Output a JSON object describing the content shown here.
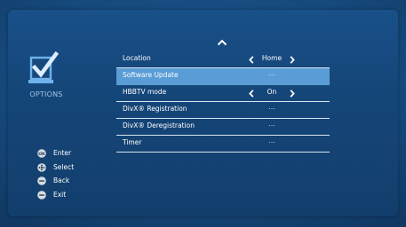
{
  "sidebar": {
    "title": "OPTIONS",
    "icon": "checklist-icon"
  },
  "menu": {
    "items": [
      {
        "label": "Location",
        "value": "Home",
        "selector": true
      },
      {
        "label": "Software Update",
        "value": "...",
        "selected": true
      },
      {
        "label": "HBBTV mode",
        "value": "On",
        "selector": true
      },
      {
        "label": "DivX® Registration",
        "value": "..."
      },
      {
        "label": "DivX® Deregistration",
        "value": "..."
      },
      {
        "label": "Timer",
        "value": "..."
      }
    ]
  },
  "legend": {
    "items": [
      {
        "button": "OK",
        "label": "Enter",
        "icon": "ok-button-icon"
      },
      {
        "button": "",
        "label": "Select",
        "icon": "dpad-button-icon"
      },
      {
        "button": "",
        "label": "Back",
        "icon": "back-button-icon"
      },
      {
        "button": "",
        "label": "Exit",
        "icon": "exit-button-icon"
      }
    ]
  },
  "colors": {
    "background": "#164a7e",
    "highlight": "#5a9cd6",
    "divider": "#d9e4ef",
    "label_accent": "#9ec4e8"
  }
}
